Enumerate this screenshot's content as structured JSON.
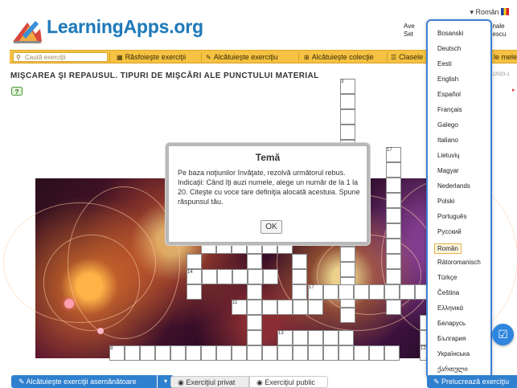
{
  "header": {
    "language_current": "Român",
    "logo_text": "LearningApps.org",
    "right_text_1": "Ave",
    "right_text_2": "Set",
    "right_text_3": "onale",
    "right_text_4": "nescu"
  },
  "menu": {
    "search_placeholder": "Caută exerciţii",
    "items": [
      "Răsfoieşte exerciţii",
      "Alcătuieşte exerciţiu",
      "Alcătuieşte colecţie",
      "Clasele",
      "le mele"
    ]
  },
  "page": {
    "title": "MIŞCAREA ŞI REPAUSUL. TIPURI DE MIŞCĂRI ALE PUNCTULUI MATERIAL",
    "date_fragment": "0 (2023-1"
  },
  "crossword": {
    "clue_numbers": [
      "3",
      "17",
      "14",
      "17",
      "11",
      "13",
      "8",
      "12"
    ]
  },
  "modal": {
    "title": "Temă",
    "body": "Pe baza noţiunilor învăţate, rezolvă următorul rebus. Indicaţii: Când îţi auzi numele, alege un număr de la 1 la 20. Citeşte cu voce tare definiţia alocată acestuia. Spune răspunsul tău.",
    "ok_label": "OK"
  },
  "languages": {
    "items": [
      "Bosanski",
      "Deutsch",
      "Eesti",
      "English",
      "Español",
      "Français",
      "Galego",
      "Italiano",
      "Lietuvių",
      "Magyar",
      "Nederlands",
      "Polski",
      "Português",
      "Русский",
      "Român",
      "Rätoromanisch",
      "Türkçe",
      "Čeština",
      "Ελληνικά",
      "Беларусь",
      "България",
      "Українська",
      "ქართული"
    ],
    "selected": "Român"
  },
  "bottom": {
    "similar_label": "Alcătuieşte exerciţii asemănătoare",
    "private_label": "Exerciţiul privat",
    "public_label": "Exerciţiul public",
    "edit_label": "Prelucrează exerciţiu"
  }
}
